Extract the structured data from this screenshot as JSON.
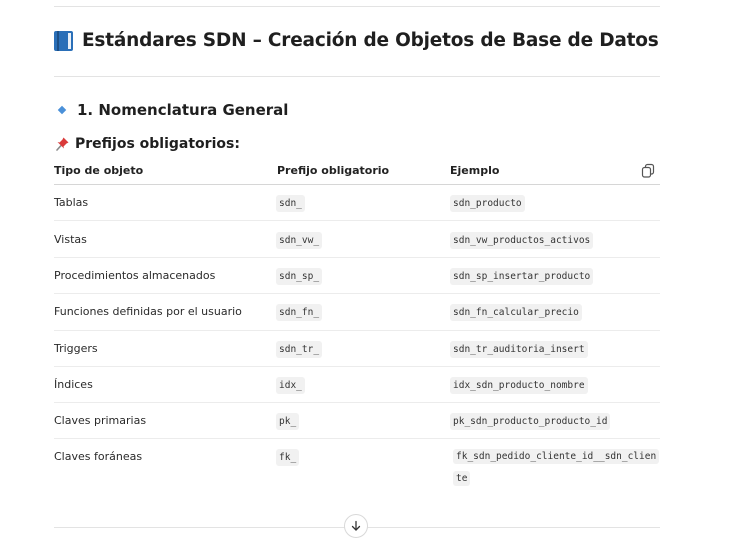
{
  "title": "Estándares SDN – Creación de Objetos de Base de Datos",
  "section": "1. Nomenclatura General",
  "subsection": "Prefijos obligatorios:",
  "table": {
    "headers": [
      "Tipo de objeto",
      "Prefijo obligatorio",
      "Ejemplo"
    ],
    "rows": [
      {
        "tipo": "Tablas",
        "prefijo": "sdn_",
        "ejemplo": "sdn_producto"
      },
      {
        "tipo": "Vistas",
        "prefijo": "sdn_vw_",
        "ejemplo": "sdn_vw_productos_activos"
      },
      {
        "tipo": "Procedimientos almacenados",
        "prefijo": "sdn_sp_",
        "ejemplo": "sdn_sp_insertar_producto"
      },
      {
        "tipo": "Funciones definidas por el usuario",
        "prefijo": "sdn_fn_",
        "ejemplo": "sdn_fn_calcular_precio"
      },
      {
        "tipo": "Triggers",
        "prefijo": "sdn_tr_",
        "ejemplo": "sdn_tr_auditoria_insert"
      },
      {
        "tipo": "Índices",
        "prefijo": "idx_",
        "ejemplo": "idx_sdn_producto_nombre"
      },
      {
        "tipo": "Claves primarias",
        "prefijo": "pk_",
        "ejemplo": "pk_sdn_producto_producto_id"
      },
      {
        "tipo": "Claves foráneas",
        "prefijo": "fk_",
        "ejemplo": "fk_sdn_pedido_cliente_id__sdn_cliente"
      }
    ]
  },
  "icons": {
    "title": "book-icon",
    "section": "small-blue-diamond-icon",
    "subsection": "pushpin-icon",
    "copy": "copy-icon",
    "scroll": "arrow-down-icon"
  },
  "colors": {
    "accent_blue": "#2a6fb8",
    "code_background": "#f1f1f1",
    "divider": "#e3e3e3",
    "pin_red": "#d93a3a"
  }
}
